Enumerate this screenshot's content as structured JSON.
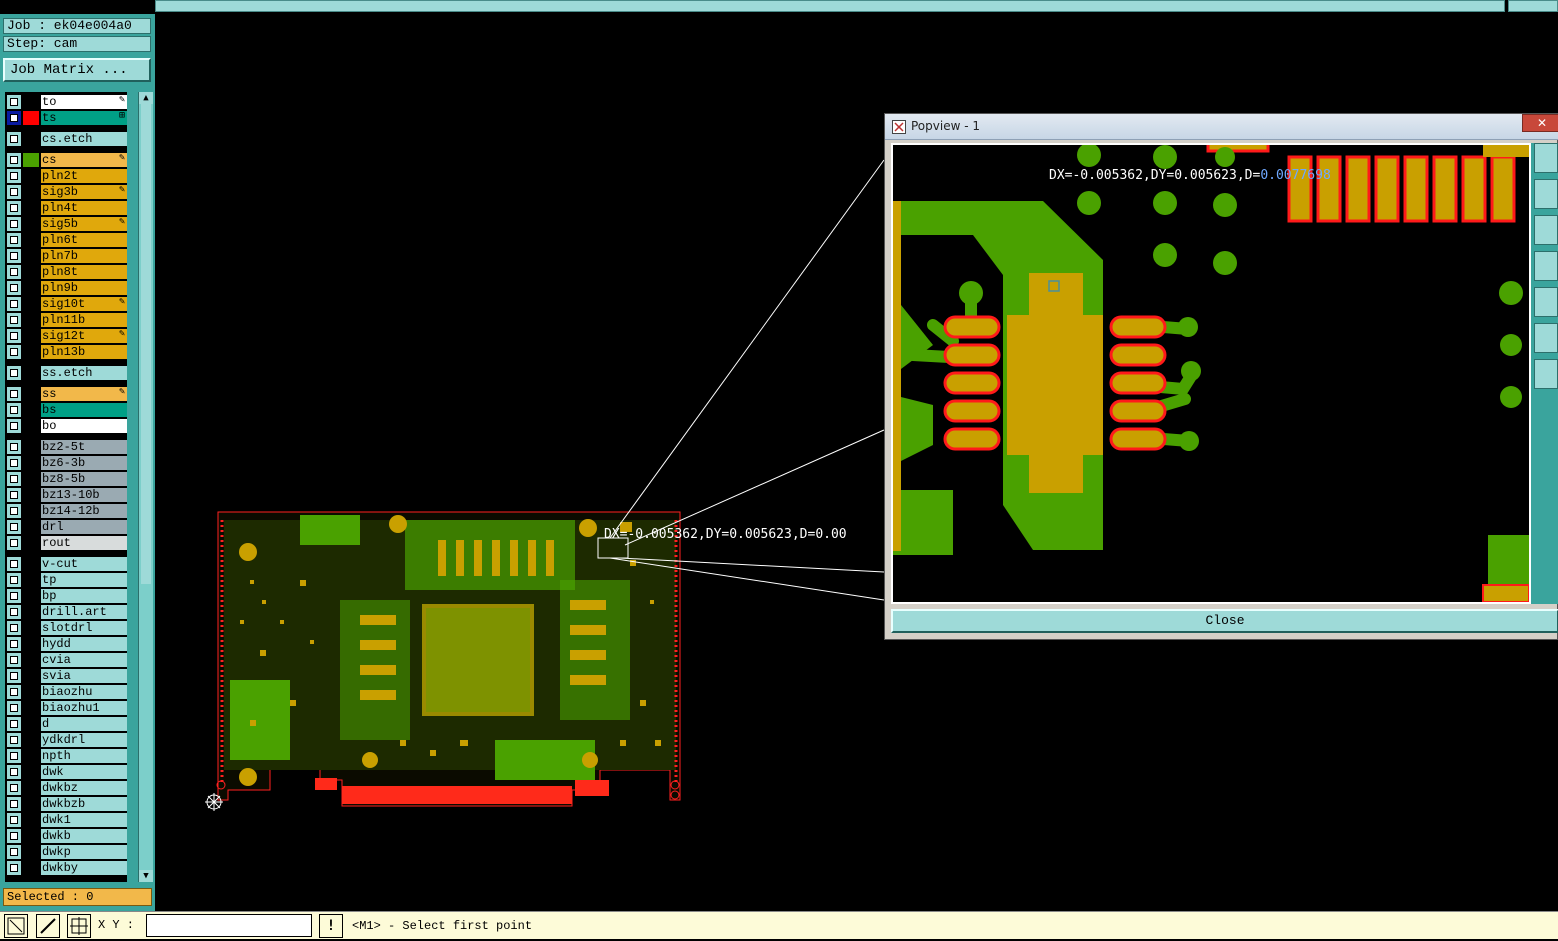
{
  "job": {
    "label": "Job : ek04e004a0",
    "step": "Step: cam"
  },
  "buttons": {
    "job_matrix": "Job Matrix ...",
    "close": "Close"
  },
  "colors": {
    "panel": "#3aa49d",
    "panel_light": "#9edad8",
    "signal": "#e0a80c",
    "active_bs": "#00a086",
    "copper": "#4aa100",
    "pad": "#c9a000",
    "pad_outline": "#ff1a1a"
  },
  "layers": [
    {
      "name": "to",
      "color": "#ffffff",
      "swatch": "#000000",
      "mark": "✎"
    },
    {
      "name": "ts",
      "color": "#00a086",
      "swatch": "#ff0000",
      "mark": "⊞",
      "selected": true
    },
    {
      "name": "cs.etch",
      "color": "#9edad8",
      "swatch": "#000000"
    },
    {
      "name": "cs",
      "color": "#f2b84a",
      "swatch": "#4aa100",
      "mark": "✎"
    },
    {
      "name": "pln2t",
      "color": "#e0a80c",
      "swatch": "#000000"
    },
    {
      "name": "sig3b",
      "color": "#e0a80c",
      "swatch": "#000000",
      "mark": "✎"
    },
    {
      "name": "pln4t",
      "color": "#e0a80c",
      "swatch": "#000000"
    },
    {
      "name": "sig5b",
      "color": "#e0a80c",
      "swatch": "#000000",
      "mark": "✎"
    },
    {
      "name": "pln6t",
      "color": "#e0a80c",
      "swatch": "#000000"
    },
    {
      "name": "pln7b",
      "color": "#e0a80c",
      "swatch": "#000000"
    },
    {
      "name": "pln8t",
      "color": "#e0a80c",
      "swatch": "#000000"
    },
    {
      "name": "pln9b",
      "color": "#e0a80c",
      "swatch": "#000000"
    },
    {
      "name": "sig10t",
      "color": "#e0a80c",
      "swatch": "#000000",
      "mark": "✎"
    },
    {
      "name": "pln11b",
      "color": "#e0a80c",
      "swatch": "#000000"
    },
    {
      "name": "sig12t",
      "color": "#e0a80c",
      "swatch": "#000000",
      "mark": "✎"
    },
    {
      "name": "pln13b",
      "color": "#e0a80c",
      "swatch": "#000000"
    },
    {
      "name": "ss.etch",
      "color": "#9edad8",
      "swatch": "#000000"
    },
    {
      "name": "ss",
      "color": "#f2b84a",
      "swatch": "#000000",
      "mark": "✎"
    },
    {
      "name": "bs",
      "color": "#00a086",
      "swatch": "#000000"
    },
    {
      "name": "bo",
      "color": "#ffffff",
      "swatch": "#000000"
    },
    {
      "name": "bz2-5t",
      "color": "#9aaab2",
      "swatch": "#000000"
    },
    {
      "name": "bz6-3b",
      "color": "#9aaab2",
      "swatch": "#000000"
    },
    {
      "name": "bz8-5b",
      "color": "#9aaab2",
      "swatch": "#000000"
    },
    {
      "name": "bz13-10b",
      "color": "#9aaab2",
      "swatch": "#000000"
    },
    {
      "name": "bz14-12b",
      "color": "#9aaab2",
      "swatch": "#000000"
    },
    {
      "name": "drl",
      "color": "#9aaab2",
      "swatch": "#000000"
    },
    {
      "name": "rout",
      "color": "#d8dcdc",
      "swatch": "#000000"
    },
    {
      "name": "v-cut",
      "color": "#9edad8",
      "swatch": "#000000"
    },
    {
      "name": "tp",
      "color": "#9edad8",
      "swatch": "#000000"
    },
    {
      "name": "bp",
      "color": "#9edad8",
      "swatch": "#000000"
    },
    {
      "name": "drill.art",
      "color": "#9edad8",
      "swatch": "#000000"
    },
    {
      "name": "slotdrl",
      "color": "#9edad8",
      "swatch": "#000000"
    },
    {
      "name": "hydd",
      "color": "#9edad8",
      "swatch": "#000000"
    },
    {
      "name": "cvia",
      "color": "#9edad8",
      "swatch": "#000000"
    },
    {
      "name": "svia",
      "color": "#9edad8",
      "swatch": "#000000"
    },
    {
      "name": "biaozhu",
      "color": "#9edad8",
      "swatch": "#000000"
    },
    {
      "name": "biaozhu1",
      "color": "#9edad8",
      "swatch": "#000000"
    },
    {
      "name": "d",
      "color": "#9edad8",
      "swatch": "#000000"
    },
    {
      "name": "ydkdrl",
      "color": "#9edad8",
      "swatch": "#000000"
    },
    {
      "name": "npth",
      "color": "#9edad8",
      "swatch": "#000000"
    },
    {
      "name": "dwk",
      "color": "#9edad8",
      "swatch": "#000000"
    },
    {
      "name": "dwkbz",
      "color": "#9edad8",
      "swatch": "#000000"
    },
    {
      "name": "dwkbzb",
      "color": "#9edad8",
      "swatch": "#000000"
    },
    {
      "name": "dwk1",
      "color": "#9edad8",
      "swatch": "#000000"
    },
    {
      "name": "dwkb",
      "color": "#9edad8",
      "swatch": "#000000"
    },
    {
      "name": "dwkp",
      "color": "#9edad8",
      "swatch": "#000000"
    },
    {
      "name": "dwkby",
      "color": "#9edad8",
      "swatch": "#000000"
    }
  ],
  "selected": "Selected : 0",
  "xy_label": "X Y :",
  "xy_value": "",
  "status": "<M1> - Select first point",
  "popview": {
    "title": "Popview - 1"
  },
  "measure": {
    "main": "DX=-0.005362,DY=0.005623,D=0.00",
    "pop_prefix": "DX=-0.005362,DY=0.005623,D=",
    "pop_d": "0.0077698"
  },
  "icons": [
    "zoom-fit-icon",
    "grid-icon",
    "crosshair-icon",
    "exclamation-icon"
  ]
}
